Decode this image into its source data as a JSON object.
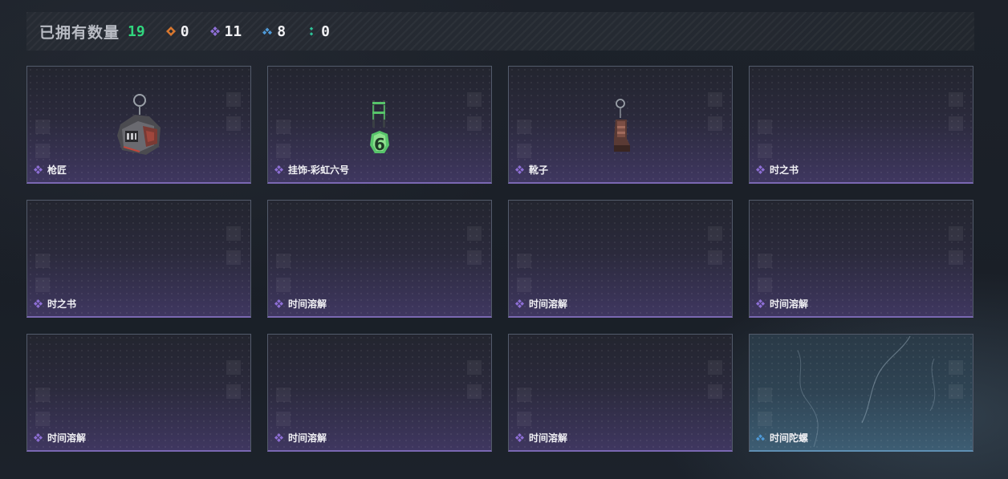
{
  "header": {
    "title": "已拥有数量",
    "total": "19",
    "rarities": [
      {
        "icon": "orange-diamond-icon",
        "color": "#d9772e",
        "count": "0"
      },
      {
        "icon": "purple-diamond-icon",
        "color": "#8e6fd6",
        "count": "11"
      },
      {
        "icon": "blue-diamond-icon",
        "color": "#4f9ad8",
        "count": "8"
      },
      {
        "icon": "green-diamond-icon",
        "color": "#2fc59a",
        "count": "0"
      }
    ]
  },
  "colors": {
    "accent_green": "#31d67e",
    "purple_rarity": "#8e6fd6",
    "blue_rarity": "#4f9ad8"
  },
  "items": [
    {
      "name": "枪匠",
      "rarity": "purple",
      "art": "keychain-charm-icon"
    },
    {
      "name": "挂饰-彩虹六号",
      "rarity": "purple",
      "art": "rainbow-six-charm-icon"
    },
    {
      "name": "靴子",
      "rarity": "purple",
      "art": "boot-charm-icon"
    },
    {
      "name": "时之书",
      "rarity": "purple",
      "art": ""
    },
    {
      "name": "时之书",
      "rarity": "purple",
      "art": ""
    },
    {
      "name": "时间溶解",
      "rarity": "purple",
      "art": ""
    },
    {
      "name": "时间溶解",
      "rarity": "purple",
      "art": ""
    },
    {
      "name": "时间溶解",
      "rarity": "purple",
      "art": ""
    },
    {
      "name": "时间溶解",
      "rarity": "purple",
      "art": ""
    },
    {
      "name": "时间溶解",
      "rarity": "purple",
      "art": ""
    },
    {
      "name": "时间溶解",
      "rarity": "purple",
      "art": ""
    },
    {
      "name": "时间陀螺",
      "rarity": "blue",
      "art": ""
    }
  ]
}
